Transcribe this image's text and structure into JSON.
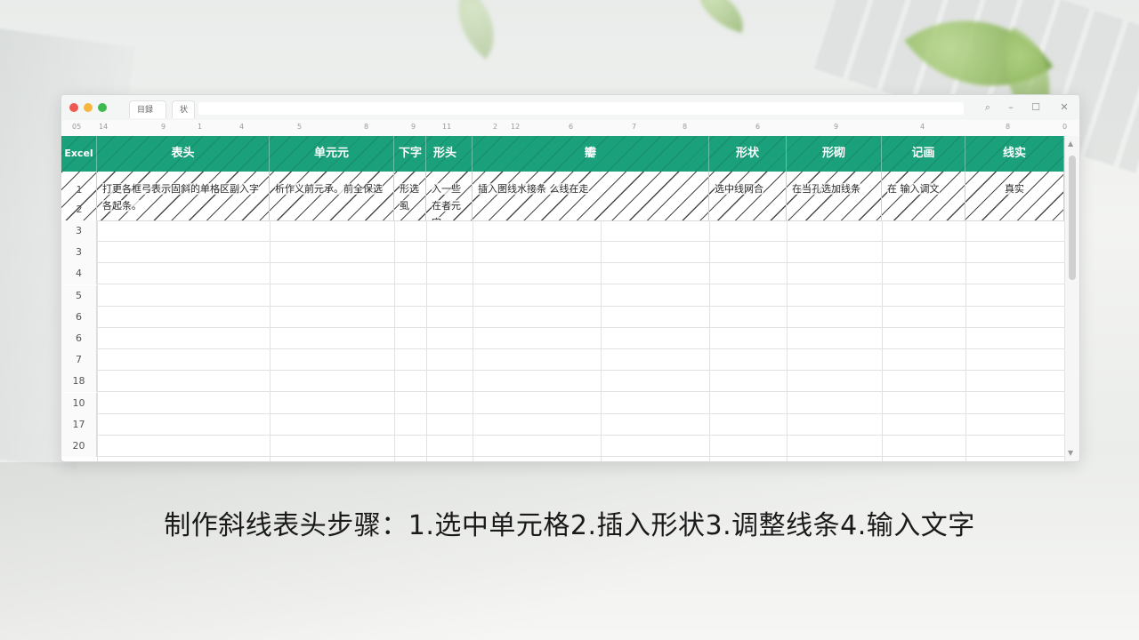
{
  "window": {
    "tabs": [
      "目録",
      "状"
    ],
    "controls": {
      "search": "⌕",
      "minimize": "–",
      "maximize": "☐",
      "close": "✕"
    }
  },
  "ruler": [
    "05",
    "14",
    "9",
    "1",
    "4",
    "5",
    "8",
    "9",
    "11",
    "2",
    "12",
    "6",
    "7",
    "8",
    "6",
    "9",
    "4",
    "8",
    "0"
  ],
  "header": {
    "corner": "Excel",
    "columns": [
      "表头",
      "单元元",
      "下字",
      "形头",
      "瓣",
      "形状",
      "形砌",
      "记画",
      "线实"
    ]
  },
  "data_row": {
    "row_numbers": [
      "1",
      "2"
    ],
    "cells": [
      "打更各框弓表示固斜的单格区副入字各起条。",
      "析作义前元承。前全保选",
      "形选虱",
      "入一些在者元字",
      "插入图线水接条 么线在走",
      "选中线网合",
      "在当孔选加线条",
      "在 输入调文",
      "真实"
    ]
  },
  "row_numbers": [
    "3",
    "3",
    "4",
    "5",
    "6",
    "6",
    "7",
    "18",
    "10",
    "17",
    "20"
  ],
  "caption": "制作斜线表头步骤：1.选中单元格2.插入形状3.调整线条4.输入文字"
}
